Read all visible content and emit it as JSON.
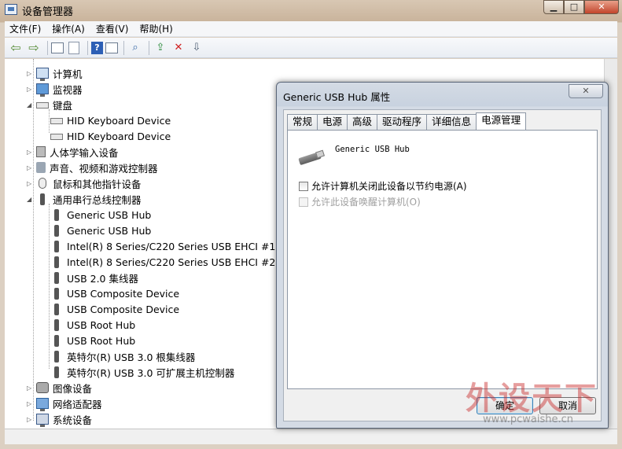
{
  "window": {
    "title": "设备管理器",
    "controls": {
      "minimize": "▁",
      "maximize": "□",
      "close": "✕"
    }
  },
  "menu": [
    "文件(F)",
    "操作(A)",
    "查看(V)",
    "帮助(H)"
  ],
  "toolbar": [
    "back-icon",
    "forward-icon",
    "properties-icon",
    "document-icon",
    "help-icon",
    "grid-icon",
    "scan-icon",
    "update-driver-icon",
    "uninstall-icon",
    "disable-icon"
  ],
  "tree": {
    "top": [
      {
        "label": "计算机",
        "icon": "computer-icon",
        "expanded": false
      },
      {
        "label": "监视器",
        "icon": "monitor-icon",
        "expanded": false
      },
      {
        "label": "键盘",
        "icon": "keyboard-icon",
        "expanded": true
      }
    ],
    "keyboard_children": [
      "HID Keyboard Device",
      "HID Keyboard Device"
    ],
    "mid": [
      {
        "label": "人体学输入设备",
        "icon": "hid-icon",
        "expanded": false
      },
      {
        "label": "声音、视频和游戏控制器",
        "icon": "sound-icon",
        "expanded": false
      },
      {
        "label": "鼠标和其他指针设备",
        "icon": "mouse-icon",
        "expanded": false
      },
      {
        "label": "通用串行总线控制器",
        "icon": "usb-icon",
        "expanded": true
      }
    ],
    "usb_children": [
      "Generic USB Hub",
      "Generic USB Hub",
      "Intel(R) 8 Series/C220 Series USB EHCI #1 - 8",
      "Intel(R) 8 Series/C220 Series USB EHCI #2 - 8",
      "USB 2.0 集线器",
      "USB Composite Device",
      "USB Composite Device",
      "USB Root Hub",
      "USB Root Hub",
      "英特尔(R) USB 3.0 根集线器",
      "英特尔(R) USB 3.0 可扩展主机控制器"
    ],
    "bottom": [
      {
        "label": "图像设备",
        "icon": "camera-icon",
        "expanded": false
      },
      {
        "label": "网络适配器",
        "icon": "network-icon",
        "expanded": false
      },
      {
        "label": "系统设备",
        "icon": "system-icon",
        "expanded": false
      }
    ]
  },
  "dialog": {
    "title": "Generic USB Hub 属性",
    "close": "✕",
    "tabs": [
      "常规",
      "电源",
      "高级",
      "驱动程序",
      "详细信息",
      "电源管理"
    ],
    "active_tab": "电源管理",
    "device_name": "Generic USB Hub",
    "checkbox1": "允许计算机关闭此设备以节约电源(A)",
    "checkbox2": "允许此设备唤醒计算机(O)",
    "ok": "确定",
    "cancel": "取消"
  },
  "watermark": {
    "big": "外设天下",
    "small": "www.pcwaishe.cn"
  }
}
